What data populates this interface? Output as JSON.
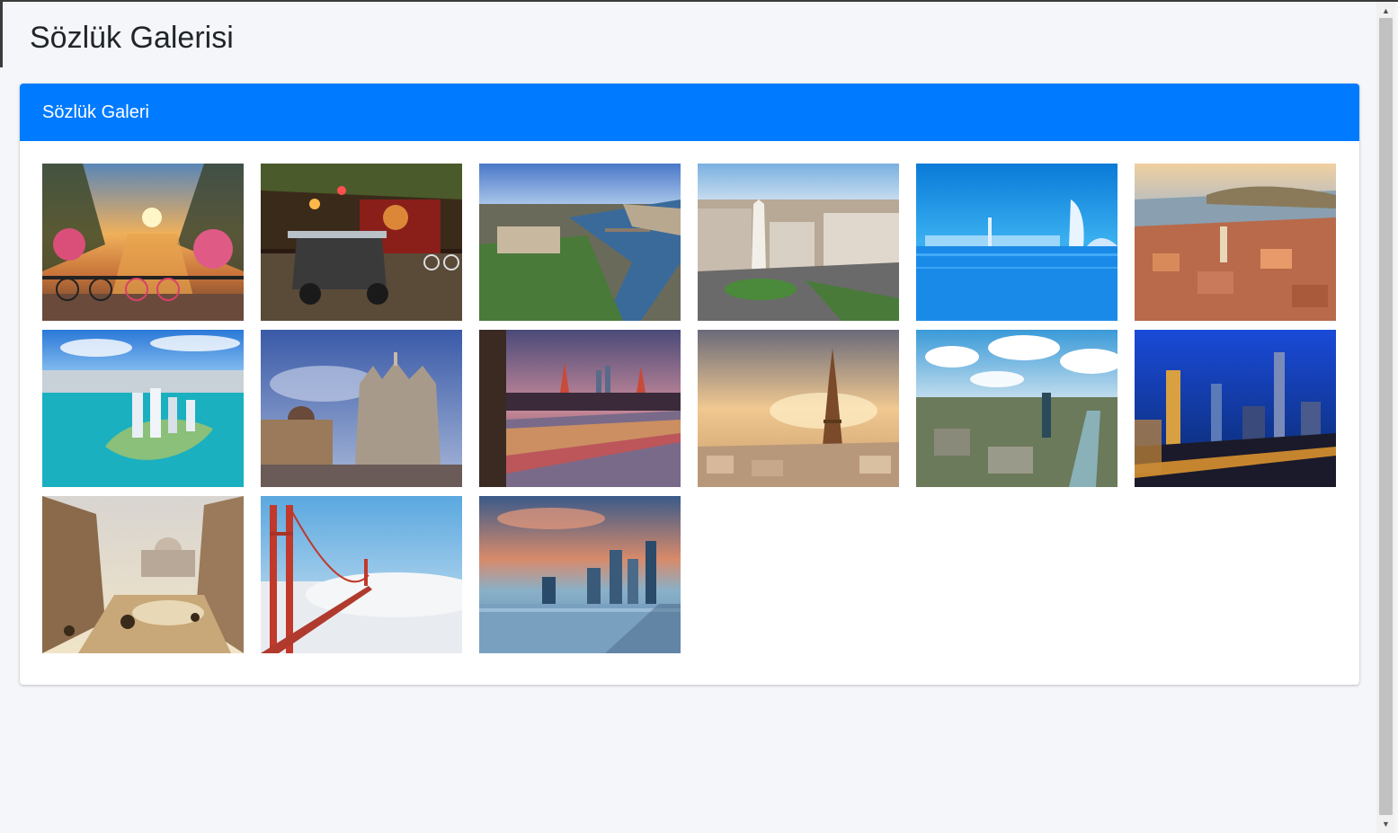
{
  "page": {
    "title": "Sözlük Galerisi"
  },
  "card": {
    "header": "Sözlük Galeri"
  },
  "gallery": {
    "images": [
      {
        "scene": "amsterdam-canal-sunset"
      },
      {
        "scene": "bangkok-tuk-tuk-night"
      },
      {
        "scene": "budapest-danube-aerial"
      },
      {
        "scene": "buenos-aires-obelisk"
      },
      {
        "scene": "dubai-burj-al-arab"
      },
      {
        "scene": "istanbul-galata-aerial"
      },
      {
        "scene": "miami-island-aerial"
      },
      {
        "scene": "milan-duomo"
      },
      {
        "scene": "moscow-kremlin-dusk"
      },
      {
        "scene": "paris-eiffel-tower"
      },
      {
        "scene": "seoul-river-aerial"
      },
      {
        "scene": "beijing-skyline-night"
      },
      {
        "scene": "rome-street-st-peters"
      },
      {
        "scene": "san-francisco-golden-gate"
      },
      {
        "scene": "singapore-skyline"
      }
    ]
  },
  "scrollbar": {
    "up_icon": "triangle-up",
    "down_icon": "triangle-down"
  }
}
